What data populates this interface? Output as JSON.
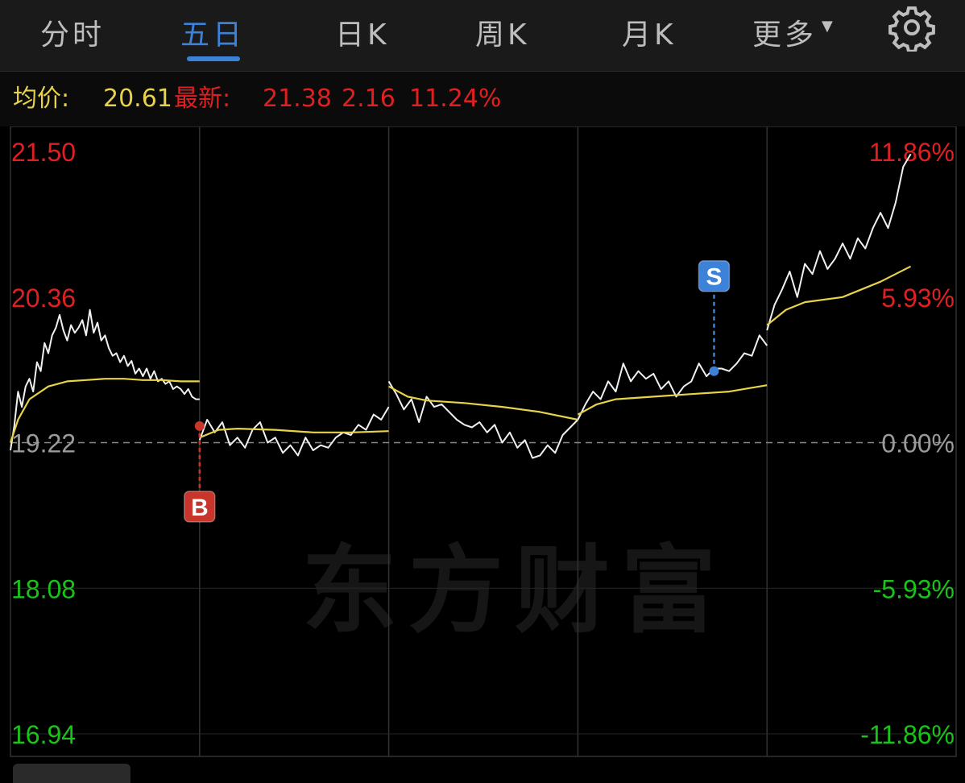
{
  "tabs": [
    {
      "label": "分时",
      "active": false
    },
    {
      "label": "五日",
      "active": true
    },
    {
      "label": "日K",
      "active": false
    },
    {
      "label": "周K",
      "active": false
    },
    {
      "label": "月K",
      "active": false
    },
    {
      "label": "更多",
      "active": false
    }
  ],
  "more_caret": "▼",
  "settings_icon": "gear-icon",
  "info": {
    "avg_label": "均价:",
    "avg_value": "20.61",
    "latest_label": "最新:",
    "latest_price": "21.38",
    "change": "2.16",
    "change_pct": "11.24%"
  },
  "watermark": "东方财富",
  "colors": {
    "up": "#e02020",
    "down": "#18c418",
    "neutral": "#9a9a9a",
    "price_line": "#f0f0f0",
    "avg_line": "#e8d24a",
    "accent": "#3b82d8",
    "buy_marker": "#c8352b",
    "sell_marker": "#3b82d8"
  },
  "chart_data": {
    "type": "line",
    "title": "",
    "days": 5,
    "ylim": [
      16.94,
      21.5
    ],
    "prev_close": 19.22,
    "y_ticks_left": [
      "21.50",
      "20.36",
      "19.22",
      "18.08",
      "16.94"
    ],
    "y_ticks_right": [
      "11.86%",
      "5.93%",
      "0.00%",
      "-5.93%",
      "-11.86%"
    ],
    "series": [
      {
        "key": "price",
        "per_day": [
          [
            [
              0,
              19.16
            ],
            [
              2,
              19.35
            ],
            [
              4,
              19.62
            ],
            [
              6,
              19.5
            ],
            [
              8,
              19.66
            ],
            [
              10,
              19.72
            ],
            [
              12,
              19.62
            ],
            [
              14,
              19.85
            ],
            [
              16,
              19.78
            ],
            [
              18,
              20.0
            ],
            [
              20,
              19.92
            ],
            [
              22,
              20.06
            ],
            [
              24,
              20.12
            ],
            [
              26,
              20.22
            ],
            [
              28,
              20.1
            ],
            [
              30,
              20.02
            ],
            [
              32,
              20.14
            ],
            [
              34,
              20.08
            ],
            [
              36,
              20.12
            ],
            [
              38,
              20.18
            ],
            [
              40,
              20.06
            ],
            [
              42,
              20.26
            ],
            [
              44,
              20.08
            ],
            [
              46,
              20.16
            ],
            [
              48,
              20.02
            ],
            [
              50,
              20.06
            ],
            [
              52,
              19.96
            ],
            [
              54,
              19.9
            ],
            [
              56,
              19.92
            ],
            [
              58,
              19.85
            ],
            [
              60,
              19.9
            ],
            [
              62,
              19.82
            ],
            [
              64,
              19.86
            ],
            [
              66,
              19.76
            ],
            [
              68,
              19.8
            ],
            [
              70,
              19.74
            ],
            [
              72,
              19.8
            ],
            [
              74,
              19.72
            ],
            [
              76,
              19.78
            ],
            [
              78,
              19.7
            ],
            [
              80,
              19.72
            ],
            [
              82,
              19.68
            ],
            [
              84,
              19.7
            ],
            [
              86,
              19.64
            ],
            [
              88,
              19.66
            ],
            [
              90,
              19.64
            ],
            [
              92,
              19.6
            ],
            [
              94,
              19.64
            ],
            [
              96,
              19.58
            ],
            [
              98,
              19.56
            ],
            [
              100,
              19.56
            ]
          ],
          [
            [
              0,
              19.24
            ],
            [
              4,
              19.4
            ],
            [
              8,
              19.3
            ],
            [
              12,
              19.38
            ],
            [
              16,
              19.2
            ],
            [
              20,
              19.26
            ],
            [
              24,
              19.18
            ],
            [
              28,
              19.32
            ],
            [
              32,
              19.38
            ],
            [
              36,
              19.22
            ],
            [
              40,
              19.26
            ],
            [
              44,
              19.14
            ],
            [
              48,
              19.2
            ],
            [
              52,
              19.12
            ],
            [
              56,
              19.26
            ],
            [
              60,
              19.16
            ],
            [
              64,
              19.2
            ],
            [
              68,
              19.18
            ],
            [
              72,
              19.26
            ],
            [
              76,
              19.3
            ],
            [
              80,
              19.28
            ],
            [
              84,
              19.36
            ],
            [
              88,
              19.32
            ],
            [
              92,
              19.44
            ],
            [
              96,
              19.4
            ],
            [
              100,
              19.5
            ]
          ],
          [
            [
              0,
              19.7
            ],
            [
              4,
              19.6
            ],
            [
              8,
              19.48
            ],
            [
              12,
              19.56
            ],
            [
              16,
              19.38
            ],
            [
              20,
              19.58
            ],
            [
              24,
              19.5
            ],
            [
              28,
              19.52
            ],
            [
              32,
              19.46
            ],
            [
              36,
              19.4
            ],
            [
              40,
              19.36
            ],
            [
              44,
              19.34
            ],
            [
              48,
              19.38
            ],
            [
              52,
              19.3
            ],
            [
              56,
              19.36
            ],
            [
              60,
              19.22
            ],
            [
              64,
              19.3
            ],
            [
              68,
              19.18
            ],
            [
              72,
              19.24
            ],
            [
              76,
              19.1
            ],
            [
              80,
              19.12
            ],
            [
              84,
              19.2
            ],
            [
              88,
              19.14
            ],
            [
              92,
              19.28
            ],
            [
              96,
              19.34
            ],
            [
              100,
              19.4
            ]
          ],
          [
            [
              0,
              19.4
            ],
            [
              4,
              19.52
            ],
            [
              8,
              19.62
            ],
            [
              12,
              19.56
            ],
            [
              16,
              19.7
            ],
            [
              20,
              19.62
            ],
            [
              24,
              19.84
            ],
            [
              28,
              19.7
            ],
            [
              32,
              19.78
            ],
            [
              36,
              19.72
            ],
            [
              40,
              19.76
            ],
            [
              44,
              19.64
            ],
            [
              48,
              19.7
            ],
            [
              52,
              19.58
            ],
            [
              56,
              19.66
            ],
            [
              60,
              19.7
            ],
            [
              64,
              19.84
            ],
            [
              68,
              19.74
            ],
            [
              72,
              19.8
            ],
            [
              76,
              19.8
            ],
            [
              80,
              19.78
            ],
            [
              84,
              19.84
            ],
            [
              88,
              19.92
            ],
            [
              92,
              19.9
            ],
            [
              96,
              20.06
            ],
            [
              100,
              19.98
            ]
          ],
          [
            [
              0,
              20.1
            ],
            [
              4,
              20.3
            ],
            [
              8,
              20.42
            ],
            [
              12,
              20.56
            ],
            [
              16,
              20.36
            ],
            [
              20,
              20.62
            ],
            [
              24,
              20.54
            ],
            [
              28,
              20.72
            ],
            [
              32,
              20.58
            ],
            [
              36,
              20.66
            ],
            [
              40,
              20.78
            ],
            [
              44,
              20.66
            ],
            [
              48,
              20.82
            ],
            [
              52,
              20.74
            ],
            [
              56,
              20.9
            ],
            [
              60,
              21.02
            ],
            [
              64,
              20.9
            ],
            [
              68,
              21.1
            ],
            [
              72,
              21.38
            ],
            [
              76,
              21.48
            ]
          ]
        ]
      },
      {
        "key": "average",
        "per_day": [
          [
            [
              0,
              19.22
            ],
            [
              4,
              19.4
            ],
            [
              10,
              19.56
            ],
            [
              20,
              19.66
            ],
            [
              30,
              19.7
            ],
            [
              40,
              19.71
            ],
            [
              50,
              19.72
            ],
            [
              60,
              19.72
            ],
            [
              70,
              19.71
            ],
            [
              80,
              19.71
            ],
            [
              90,
              19.7
            ],
            [
              100,
              19.7
            ]
          ],
          [
            [
              0,
              19.26
            ],
            [
              10,
              19.32
            ],
            [
              20,
              19.33
            ],
            [
              40,
              19.32
            ],
            [
              60,
              19.3
            ],
            [
              80,
              19.3
            ],
            [
              100,
              19.31
            ]
          ],
          [
            [
              0,
              19.66
            ],
            [
              10,
              19.58
            ],
            [
              20,
              19.55
            ],
            [
              40,
              19.53
            ],
            [
              60,
              19.5
            ],
            [
              80,
              19.46
            ],
            [
              100,
              19.4
            ]
          ],
          [
            [
              0,
              19.44
            ],
            [
              10,
              19.52
            ],
            [
              20,
              19.56
            ],
            [
              40,
              19.58
            ],
            [
              60,
              19.6
            ],
            [
              80,
              19.62
            ],
            [
              100,
              19.67
            ]
          ],
          [
            [
              0,
              20.14
            ],
            [
              10,
              20.26
            ],
            [
              20,
              20.32
            ],
            [
              40,
              20.36
            ],
            [
              60,
              20.48
            ],
            [
              76,
              20.6
            ]
          ]
        ]
      }
    ],
    "markers": [
      {
        "label": "B",
        "type": "buy",
        "day": 1,
        "t": 0,
        "price": 19.35
      },
      {
        "label": "S",
        "type": "sell",
        "day": 3,
        "t": 72,
        "price": 19.78
      }
    ]
  },
  "bottom_bar": {
    "visible_fragment": true
  }
}
